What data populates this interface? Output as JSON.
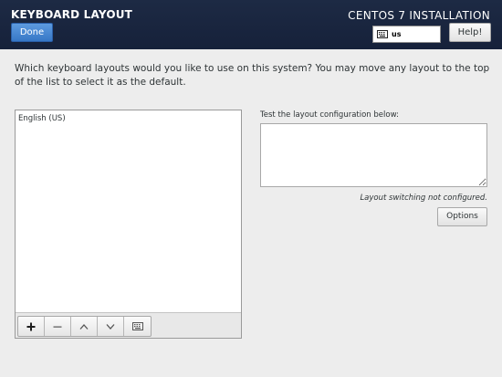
{
  "header": {
    "title": "KEYBOARD LAYOUT",
    "done_label": "Done",
    "install_title": "CENTOS 7 INSTALLATION",
    "keyboard_code": "us",
    "help_label": "Help!"
  },
  "intro": {
    "text": "Which keyboard layouts would you like to use on this system?  You may move any layout to the top of the list to select it as the default."
  },
  "layouts": {
    "items": [
      {
        "label": "English (US)"
      }
    ]
  },
  "toolbar": {
    "icons": [
      "add-icon",
      "remove-icon",
      "move-up-icon",
      "move-down-icon",
      "keyboard-preview-icon"
    ]
  },
  "test": {
    "label": "Test the layout configuration below:",
    "value": ""
  },
  "switching": {
    "note": "Layout switching not configured.",
    "options_label": "Options"
  },
  "colors": {
    "header_bg": "#1d2a44",
    "accent": "#3777c6",
    "page_bg": "#ededed"
  }
}
